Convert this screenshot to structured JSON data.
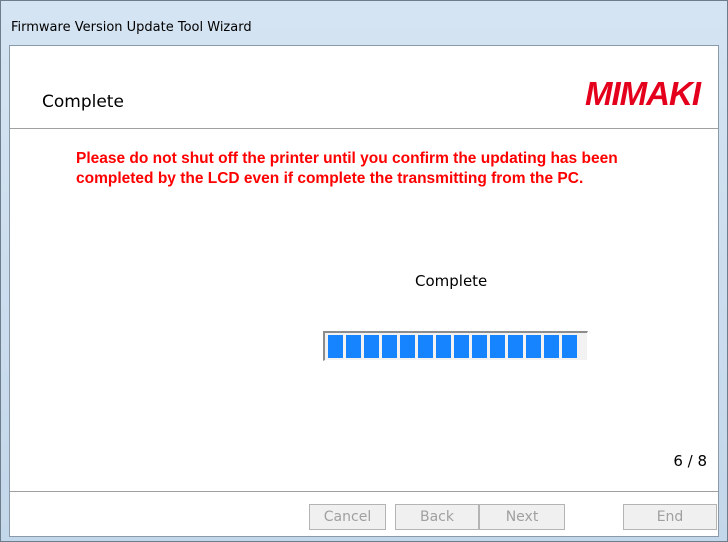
{
  "window": {
    "title": "Firmware Version Update Tool Wizard"
  },
  "header": {
    "page_title": "Complete",
    "logo": {
      "text": "MIMAKI",
      "color": "#e4001d"
    }
  },
  "warning": {
    "text": "Please do not shut off the printer until you confirm the updating has been completed by the LCD even if complete the transmitting from the PC.",
    "color": "#ff0000"
  },
  "status": {
    "text": "Complete",
    "progress_fraction": 1.0,
    "progress_color": "#1683ff"
  },
  "page_counter": "6 / 8",
  "buttons": {
    "cancel": "Cancel",
    "back": "Back",
    "next": "Next",
    "end": "End"
  }
}
